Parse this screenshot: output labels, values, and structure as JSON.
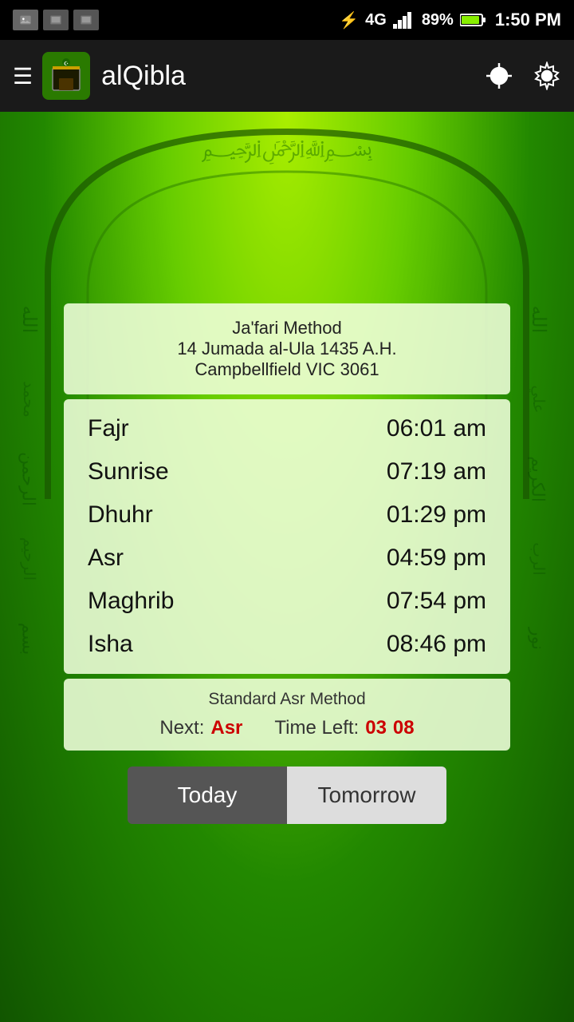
{
  "statusBar": {
    "bluetooth": "⌂",
    "network": "4G",
    "signal": "▲▲▲▲",
    "battery": "89%",
    "time": "1:50 PM"
  },
  "appBar": {
    "title": "alQibla",
    "menuIcon": "menu-icon",
    "locationIcon": "location-icon",
    "settingsIcon": "settings-icon"
  },
  "infoCard": {
    "method": "Ja'fari Method",
    "date": "14 Jumada al-Ula 1435 A.H.",
    "location": "Campbellfield VIC 3061"
  },
  "prayers": [
    {
      "name": "Fajr",
      "time": "06:01 am"
    },
    {
      "name": "Sunrise",
      "time": "07:19 am"
    },
    {
      "name": "Dhuhr",
      "time": "01:29 pm"
    },
    {
      "name": "Asr",
      "time": "04:59 pm"
    },
    {
      "name": "Maghrib",
      "time": "07:54 pm"
    },
    {
      "name": "Isha",
      "time": "08:46 pm"
    }
  ],
  "footer": {
    "method": "Standard Asr Method",
    "nextLabel": "Next:",
    "nextName": "Asr",
    "timeLeftLabel": "Time Left:",
    "timeHours": "03",
    "timeMinutes": "08"
  },
  "tabs": {
    "today": "Today",
    "tomorrow": "Tomorrow"
  }
}
